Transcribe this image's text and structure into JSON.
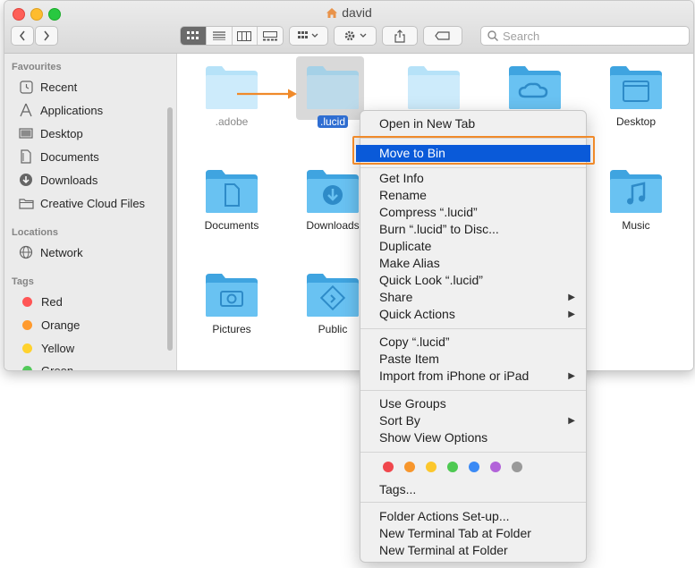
{
  "window": {
    "title": "david"
  },
  "toolbar": {
    "search_placeholder": "Search"
  },
  "sidebar": {
    "sections": [
      {
        "heading": "Favourites",
        "items": [
          {
            "label": "Recent",
            "icon": "clock-icon"
          },
          {
            "label": "Applications",
            "icon": "applications-icon"
          },
          {
            "label": "Desktop",
            "icon": "desktop-icon"
          },
          {
            "label": "Documents",
            "icon": "documents-icon"
          },
          {
            "label": "Downloads",
            "icon": "downloads-icon"
          },
          {
            "label": "Creative Cloud Files",
            "icon": "folder-icon"
          }
        ]
      },
      {
        "heading": "Locations",
        "items": [
          {
            "label": "Network",
            "icon": "globe-icon"
          }
        ]
      },
      {
        "heading": "Tags",
        "items": [
          {
            "label": "Red",
            "color": "#ff5555"
          },
          {
            "label": "Orange",
            "color": "#ff9a2e"
          },
          {
            "label": "Yellow",
            "color": "#ffd22e"
          },
          {
            "label": "Green",
            "color": "#52c95a"
          }
        ]
      }
    ]
  },
  "files": [
    {
      "name": ".adobe",
      "icon": "folder-icon"
    },
    {
      "name": ".lucid",
      "icon": "folder-icon"
    },
    {
      "name": "",
      "icon": "folder-icon"
    },
    {
      "name": "",
      "icon": "creative-cloud-folder-icon"
    },
    {
      "name": "Desktop",
      "icon": "desktop-folder-icon"
    },
    {
      "name": "Documents",
      "icon": "documents-folder-icon"
    },
    {
      "name": "Downloads",
      "icon": "downloads-folder-icon"
    },
    {
      "name": "Music",
      "icon": "music-folder-icon"
    },
    {
      "name": "Pictures",
      "icon": "pictures-folder-icon"
    },
    {
      "name": "Public",
      "icon": "public-folder-icon"
    }
  ],
  "context_menu": {
    "open_new_tab": "Open in New Tab",
    "move_to_bin": "Move to Bin",
    "get_info": "Get Info",
    "rename": "Rename",
    "compress": "Compress “.lucid”",
    "burn": "Burn “.lucid” to Disc...",
    "duplicate": "Duplicate",
    "make_alias": "Make Alias",
    "quick_look": "Quick Look “.lucid”",
    "share": "Share",
    "quick_actions": "Quick Actions",
    "copy": "Copy “.lucid”",
    "paste": "Paste Item",
    "import_iphone": "Import from iPhone or iPad",
    "use_groups": "Use Groups",
    "sort_by": "Sort By",
    "show_view_options": "Show View Options",
    "tags": "Tags...",
    "folder_actions": "Folder Actions Set-up...",
    "new_terminal_tab": "New Terminal Tab at Folder",
    "new_terminal": "New Terminal at Folder",
    "tag_colors": [
      "#f0474d",
      "#f7962c",
      "#fcc72c",
      "#4ec952",
      "#3b8af5",
      "#b263d9",
      "#9a9a9a"
    ]
  },
  "colors": {
    "highlight": "#0a5ad9",
    "annotation": "#f08a2a",
    "folder": "#7ccbf4"
  }
}
